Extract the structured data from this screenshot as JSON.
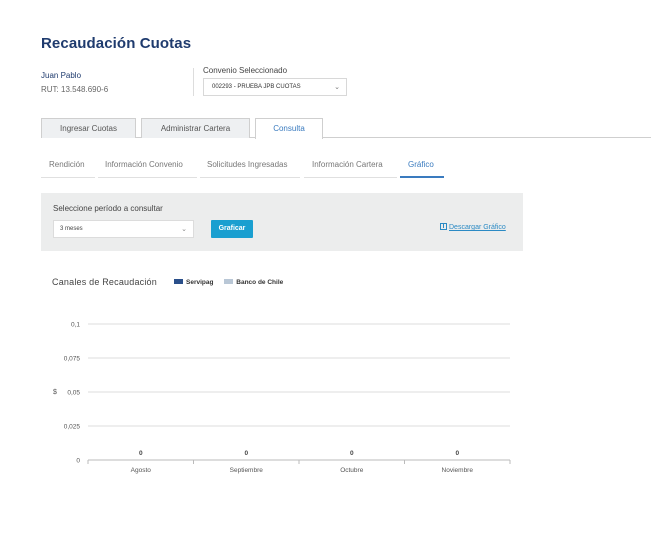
{
  "page": {
    "title": "Recaudación Cuotas"
  },
  "user": {
    "name": "Juan Pablo",
    "rut": "RUT: 13.548.690-6"
  },
  "convenio": {
    "label": "Convenio Seleccionado",
    "selected": "002293 - PRUEBA JPB CUOTAS"
  },
  "main_tabs": [
    {
      "label": "Ingresar Cuotas"
    },
    {
      "label": "Administrar Cartera"
    },
    {
      "label": "Consulta"
    }
  ],
  "sub_tabs": [
    {
      "label": "Rendición"
    },
    {
      "label": "Información Convenio"
    },
    {
      "label": "Solicitudes Ingresadas"
    },
    {
      "label": "Información Cartera"
    },
    {
      "label": "Gráfico"
    }
  ],
  "filter": {
    "label": "Seleccione período a consultar",
    "period": "3 meses",
    "graph_button": "Graficar",
    "download_link": "Descargar Gráfico"
  },
  "colors": {
    "accent": "#1a9fd0",
    "title": "#1f3b6e",
    "servipag": "#2a4f8a",
    "banco": "#b9c7d6"
  },
  "chart_data": {
    "type": "bar",
    "title": "Canales de Recaudación",
    "categories": [
      "Agosto",
      "Septiembre",
      "Octubre",
      "Noviembre"
    ],
    "series": [
      {
        "name": "Servipag",
        "values": [
          0,
          0,
          0,
          0
        ]
      },
      {
        "name": "Banco de Chile",
        "values": [
          0,
          0,
          0,
          0
        ]
      }
    ],
    "data_labels": [
      "0",
      "0",
      "0",
      "0"
    ],
    "ylabel": "$",
    "yticks": [
      "0",
      "0,025",
      "0,05",
      "0,075",
      "0,1"
    ],
    "ylim": [
      0,
      0.1
    ],
    "grid": true,
    "legend": "top"
  }
}
